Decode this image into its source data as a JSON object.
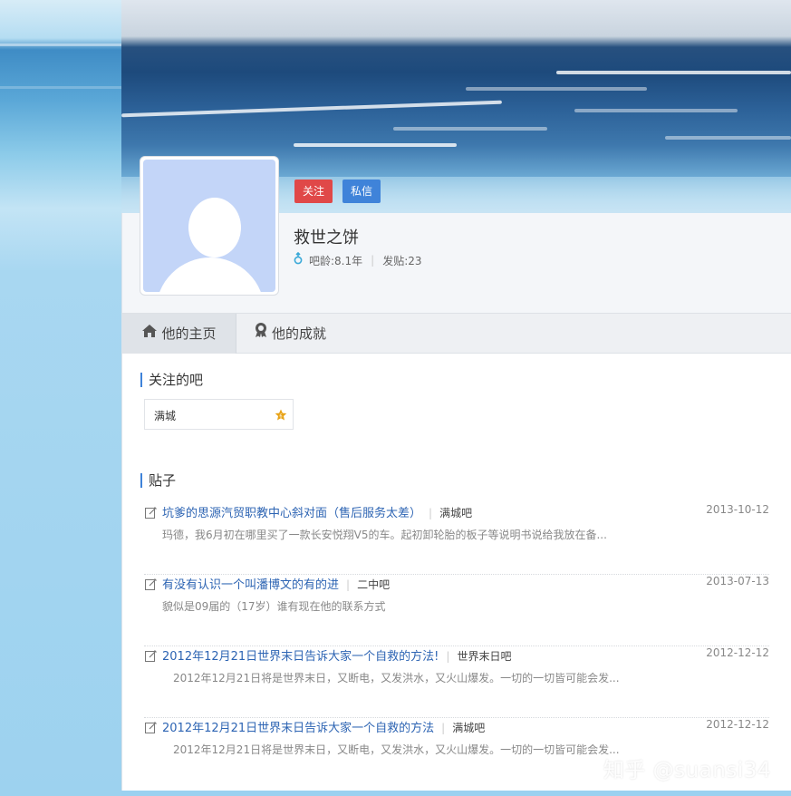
{
  "profile": {
    "username": "救世之饼",
    "follow_label": "关注",
    "message_label": "私信",
    "age_label": "吧龄:8.1年",
    "posts_label": "发贴:23",
    "gender_icon": "male-icon"
  },
  "tabs": [
    {
      "label": "他的主页",
      "icon": "home-icon"
    },
    {
      "label": "他的成就",
      "icon": "badge-icon"
    }
  ],
  "followed_bars": {
    "title": "关注的吧",
    "items": [
      {
        "name": "满城",
        "badge_icon": "level-star-icon",
        "badge_color": "#e8a317"
      }
    ]
  },
  "posts": {
    "title": "贴子",
    "items": [
      {
        "title": "坑爹的思源汽贸职教中心斜对面（售后服务太差）",
        "forum": "满城吧",
        "date": "2013-10-12",
        "excerpt": "玛德，我6月初在哪里买了一款长安悦翔V5的车。起初卸轮胎的板子等说明书说给我放在备..."
      },
      {
        "title": "有没有认识一个叫潘博文的有的进",
        "forum": "二中吧",
        "date": "2013-07-13",
        "excerpt": "貌似是09届的（17岁）谁有现在他的联系方式"
      },
      {
        "title": "2012年12月21日世界末日告诉大家一个自救的方法!",
        "forum": "世界末日吧",
        "date": "2012-12-12",
        "excerpt": "2012年12月21日将是世界末日，又断电，又发洪水，又火山爆发。一切的一切皆可能会发..."
      },
      {
        "title": "2012年12月21日世界末日告诉大家一个自救的方法",
        "forum": "满城吧",
        "date": "2012-12-12",
        "excerpt": "2012年12月21日将是世界末日，又断电，又发洪水，又火山爆发。一切的一切皆可能会发..."
      }
    ]
  },
  "watermark": "知乎 @suansi34",
  "colors": {
    "follow_button": "#e04848",
    "message_button": "#3f83d9",
    "link": "#2d64b3",
    "section_accent": "#3f83d9"
  }
}
